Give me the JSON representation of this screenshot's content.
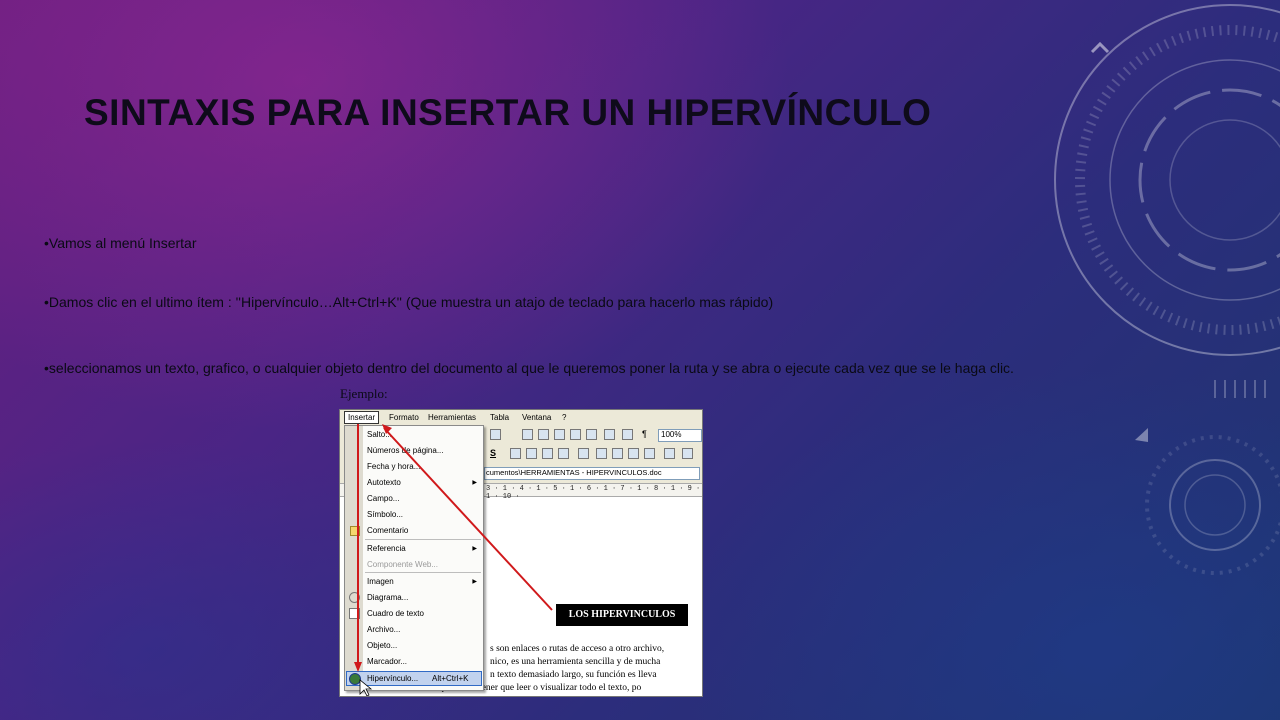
{
  "slide": {
    "title": "SINTAXIS PARA INSERTAR UN HIPERVÍNCULO",
    "bullets": [
      "•Vamos al menú Insertar",
      "•Damos clic en el ultimo ítem : ''Hipervínculo…Alt+Ctrl+K'' (Que muestra un atajo de teclado para hacerlo mas rápido)",
      "•seleccionamos un texto, grafico, o cualquier objeto dentro del documento al que le queremos poner la ruta y se abra o ejecute cada vez que se le haga clic."
    ],
    "example_label": "Ejemplo:"
  },
  "screenshot": {
    "menubar": [
      "Insertar",
      "Formato",
      "Herramientas",
      "Tabla",
      "Ventana",
      "?"
    ],
    "zoom": "100%",
    "doc_path": "cumentos\\HERRAMIENTAS - HIPERVINCULOS.doc",
    "ruler": "3 · 1 · 4 · 1 · 5 · 1 · 6 · 1 · 7 · 1 · 8 · 1 · 9 · 1 · 10 ·",
    "menu_items": [
      {
        "label": "Salto...",
        "submenu": false,
        "disabled": false
      },
      {
        "label": "Números de página...",
        "submenu": false,
        "disabled": false
      },
      {
        "label": "Fecha y hora...",
        "submenu": false,
        "disabled": false
      },
      {
        "label": "Autotexto",
        "submenu": true,
        "disabled": false
      },
      {
        "label": "Campo...",
        "submenu": false,
        "disabled": false
      },
      {
        "label": "Símbolo...",
        "submenu": false,
        "disabled": false
      },
      {
        "label": "Comentario",
        "submenu": false,
        "disabled": false
      },
      {
        "label": "Referencia",
        "submenu": true,
        "disabled": false
      },
      {
        "label": "Componente Web...",
        "submenu": false,
        "disabled": true
      },
      {
        "label": "Imagen",
        "submenu": true,
        "disabled": false
      },
      {
        "label": "Diagrama...",
        "submenu": false,
        "disabled": false
      },
      {
        "label": "Cuadro de texto",
        "submenu": false,
        "disabled": false
      },
      {
        "label": "Archivo...",
        "submenu": false,
        "disabled": false
      },
      {
        "label": "Objeto...",
        "submenu": false,
        "disabled": false
      },
      {
        "label": "Marcador...",
        "submenu": false,
        "disabled": false
      },
      {
        "label": "Hipervínculo...",
        "submenu": false,
        "disabled": false
      }
    ],
    "hyperlink_shortcut": "Alt+Ctrl+K",
    "doc_heading": "LOS HIPERVINCULOS",
    "doc_lines": [
      "s son enlaces o rutas de acceso a otro archivo,",
      "nico, es una herramienta sencilla y de mucha",
      "n texto demasiado largo, su función es lleva",
      "hasta otro punto sin tener que leer o visualizar todo el texto, po"
    ],
    "accent_color": "#d0191b"
  }
}
